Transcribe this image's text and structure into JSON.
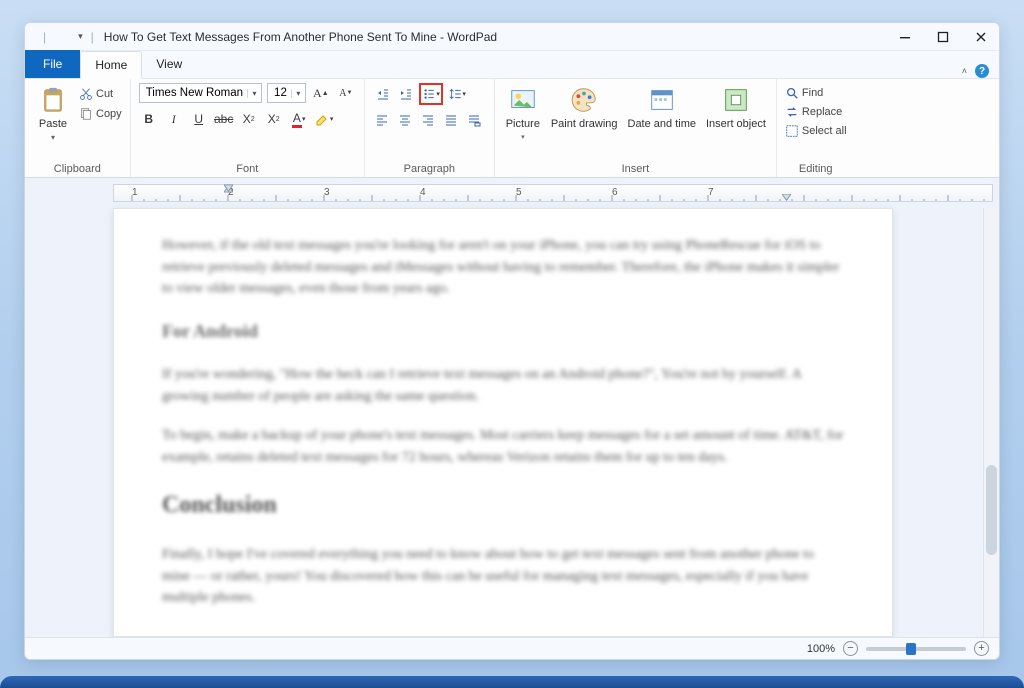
{
  "title": "How To Get Text Messages From Another Phone Sent To Mine - WordPad",
  "tabs": {
    "file": "File",
    "home": "Home",
    "view": "View"
  },
  "clipboard": {
    "label": "Clipboard",
    "paste": "Paste",
    "cut": "Cut",
    "copy": "Copy"
  },
  "font": {
    "label": "Font",
    "family": "Times New Roman",
    "size": "12"
  },
  "paragraph": {
    "label": "Paragraph"
  },
  "insert": {
    "label": "Insert",
    "picture": "Picture",
    "paint": "Paint drawing",
    "date": "Date and time",
    "object": "Insert object"
  },
  "editing": {
    "label": "Editing",
    "find": "Find",
    "replace": "Replace",
    "selectall": "Select all"
  },
  "ruler_numbers": [
    "1",
    "2",
    "3",
    "4",
    "5",
    "6",
    "7"
  ],
  "zoom": {
    "percent": "100%"
  }
}
